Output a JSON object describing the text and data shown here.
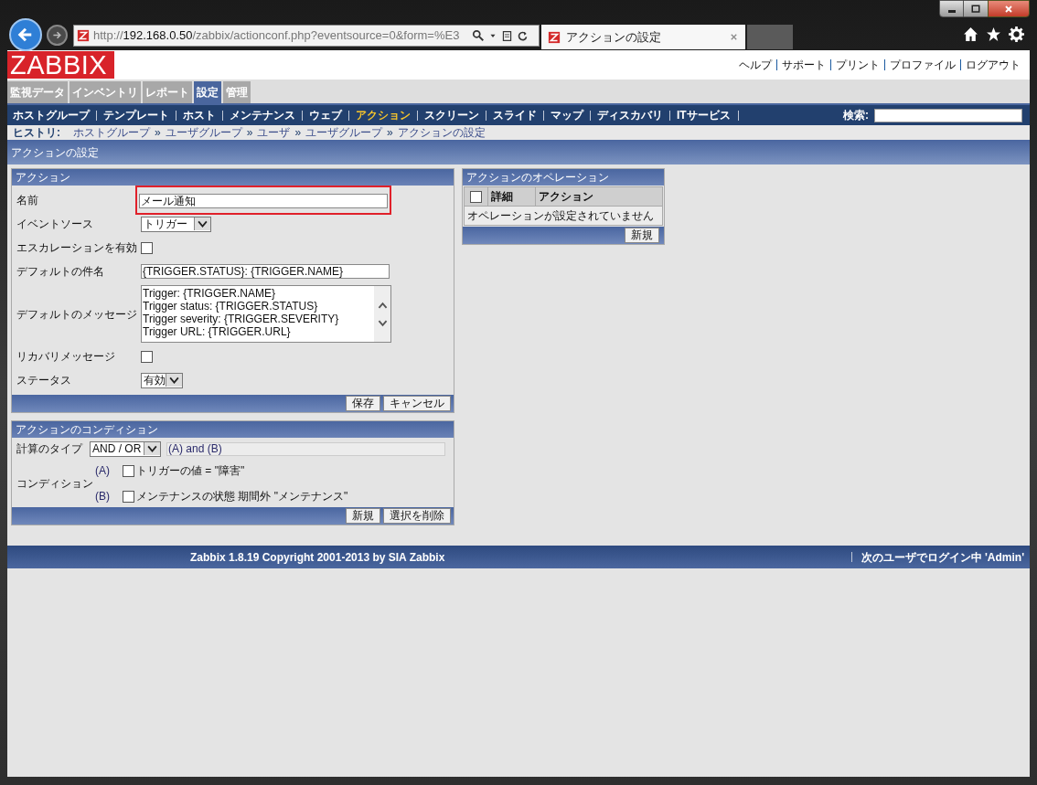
{
  "browser": {
    "url": {
      "scheme": "http://",
      "host": "192.168.0.50",
      "path": "/zabbix/actionconf.php?eventsource=0&form=%E3"
    },
    "tab_title": "アクションの設定"
  },
  "header": {
    "logo": "ZABBIX",
    "links": [
      "ヘルプ",
      "サポート",
      "プリント",
      "プロファイル",
      "ログアウト"
    ]
  },
  "main_tabs": [
    {
      "label": "監視データ",
      "selected": false
    },
    {
      "label": "インベントリ",
      "selected": false
    },
    {
      "label": "レポート",
      "selected": false
    },
    {
      "label": "設定",
      "selected": true
    },
    {
      "label": "管理",
      "selected": false
    }
  ],
  "sub_nav": [
    {
      "label": "ホストグループ",
      "selected": false
    },
    {
      "label": "テンプレート",
      "selected": false
    },
    {
      "label": "ホスト",
      "selected": false
    },
    {
      "label": "メンテナンス",
      "selected": false
    },
    {
      "label": "ウェブ",
      "selected": false
    },
    {
      "label": "アクション",
      "selected": true
    },
    {
      "label": "スクリーン",
      "selected": false
    },
    {
      "label": "スライド",
      "selected": false
    },
    {
      "label": "マップ",
      "selected": false
    },
    {
      "label": "ディスカバリ",
      "selected": false
    },
    {
      "label": "ITサービス",
      "selected": false
    }
  ],
  "search_label": "検索:",
  "history": {
    "label": "ヒストリ:",
    "items": [
      "ホストグループ",
      "ユーザグループ",
      "ユーザ",
      "ユーザグループ",
      "アクションの設定"
    ],
    "separator": "»"
  },
  "page_title": "アクションの設定",
  "action_form": {
    "title": "アクション",
    "fields": [
      {
        "kind": "text",
        "label": "名前",
        "value": "メール通知",
        "highlighted": true
      },
      {
        "kind": "select",
        "label": "イベントソース",
        "value": "トリガー"
      },
      {
        "kind": "checkbox",
        "label": "エスカレーションを有効",
        "checked": false
      },
      {
        "kind": "text",
        "label": "デフォルトの件名",
        "value": "{TRIGGER.STATUS}: {TRIGGER.NAME}",
        "highlighted": false
      },
      {
        "kind": "textarea",
        "label": "デフォルトのメッセージ",
        "lines": [
          "Trigger: {TRIGGER.NAME}",
          "Trigger status: {TRIGGER.STATUS}",
          "Trigger severity: {TRIGGER.SEVERITY}",
          "Trigger URL: {TRIGGER.URL}"
        ]
      },
      {
        "kind": "checkbox",
        "label": "リカバリメッセージ",
        "checked": false
      },
      {
        "kind": "select",
        "label": "ステータス",
        "value": "有効"
      }
    ],
    "buttons": [
      "保存",
      "キャンセル"
    ]
  },
  "conditions": {
    "title": "アクションのコンディション",
    "calc_label": "計算のタイプ",
    "calc_type": "AND / OR",
    "formula": "(A) and (B)",
    "condition_label": "コンディション",
    "items": [
      {
        "label": "(A)",
        "text": "トリガーの値 = \"障害\"",
        "checked": false
      },
      {
        "label": "(B)",
        "text": "メンテナンスの状態 期間外 \"メンテナンス\"",
        "checked": false
      }
    ],
    "buttons": [
      "新規",
      "選択を削除"
    ]
  },
  "operations": {
    "title": "アクションのオペレーション",
    "header_checked": false,
    "columns": [
      "詳細",
      "アクション"
    ],
    "empty": "オペレーションが設定されていません",
    "button": "新規"
  },
  "footer": {
    "copyright": "Zabbix 1.8.19 Copyright 2001-2013 by SIA Zabbix",
    "login": "次のユーザでログイン中 'Admin'"
  }
}
